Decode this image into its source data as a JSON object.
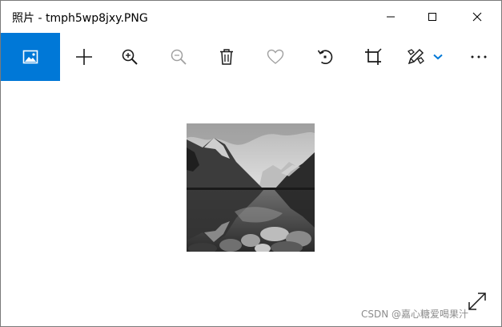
{
  "window": {
    "title": "照片 - tmph5wp8jxy.PNG"
  },
  "titlebar_buttons": {
    "minimize_icon": "minimize-icon",
    "maximize_icon": "maximize-icon",
    "close_icon": "close-icon"
  },
  "toolbar": {
    "items": [
      {
        "id": "photos",
        "icon": "photos-app-icon",
        "active": true
      },
      {
        "id": "add",
        "icon": "plus-icon"
      },
      {
        "id": "zoom-in",
        "icon": "zoom-in-icon"
      },
      {
        "id": "zoom-out",
        "icon": "zoom-out-icon",
        "disabled": true
      },
      {
        "id": "delete",
        "icon": "trash-icon"
      },
      {
        "id": "favorite",
        "icon": "heart-icon",
        "disabled": true
      },
      {
        "id": "rotate",
        "icon": "rotate-icon"
      },
      {
        "id": "crop",
        "icon": "crop-icon"
      },
      {
        "id": "edit",
        "icon": "edit-draw-icon"
      },
      {
        "id": "edit-menu",
        "icon": "chevron-down-icon"
      },
      {
        "id": "more",
        "icon": "more-icon"
      }
    ]
  },
  "viewer": {
    "image": "grayscale mountain lake photo",
    "expand_icon": "expand-icon"
  },
  "watermark": {
    "text": "CSDN @嘉心糖爱喝果汁"
  },
  "colors": {
    "accent": "#0078d7",
    "icon": "#1a1a1a",
    "icon_disabled": "#a0a0a0",
    "watermark": "#8c8c8c"
  }
}
